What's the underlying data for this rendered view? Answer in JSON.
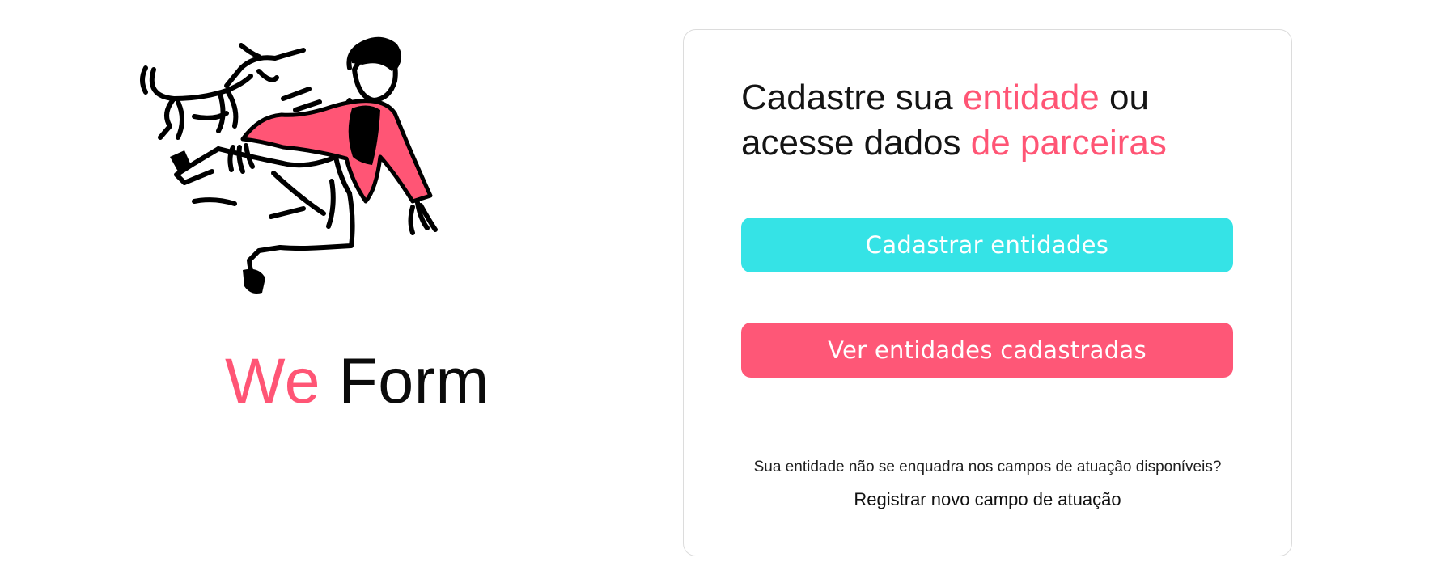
{
  "brand": {
    "illustration_icon": "jumping-person-with-dog-illustration",
    "name_part1": "We",
    "name_part2": "Form"
  },
  "card": {
    "headline": {
      "part1": "Cadastre sua ",
      "part2": "entidade",
      "part3": " ou",
      "part4": "acesse dados ",
      "part5": "de parceiras"
    },
    "register_button_label": "Cadastrar entidades",
    "view_button_label": "Ver entidades cadastradas",
    "question_text": "Sua entidade não se enquadra nos campos de atuação disponíveis?",
    "register_field_link": "Registrar novo campo de atuação"
  },
  "colors": {
    "accent_pink": "#ff5575",
    "accent_cyan": "#35e3e6",
    "text_dark": "#111111",
    "card_border": "#dcdcdc"
  }
}
